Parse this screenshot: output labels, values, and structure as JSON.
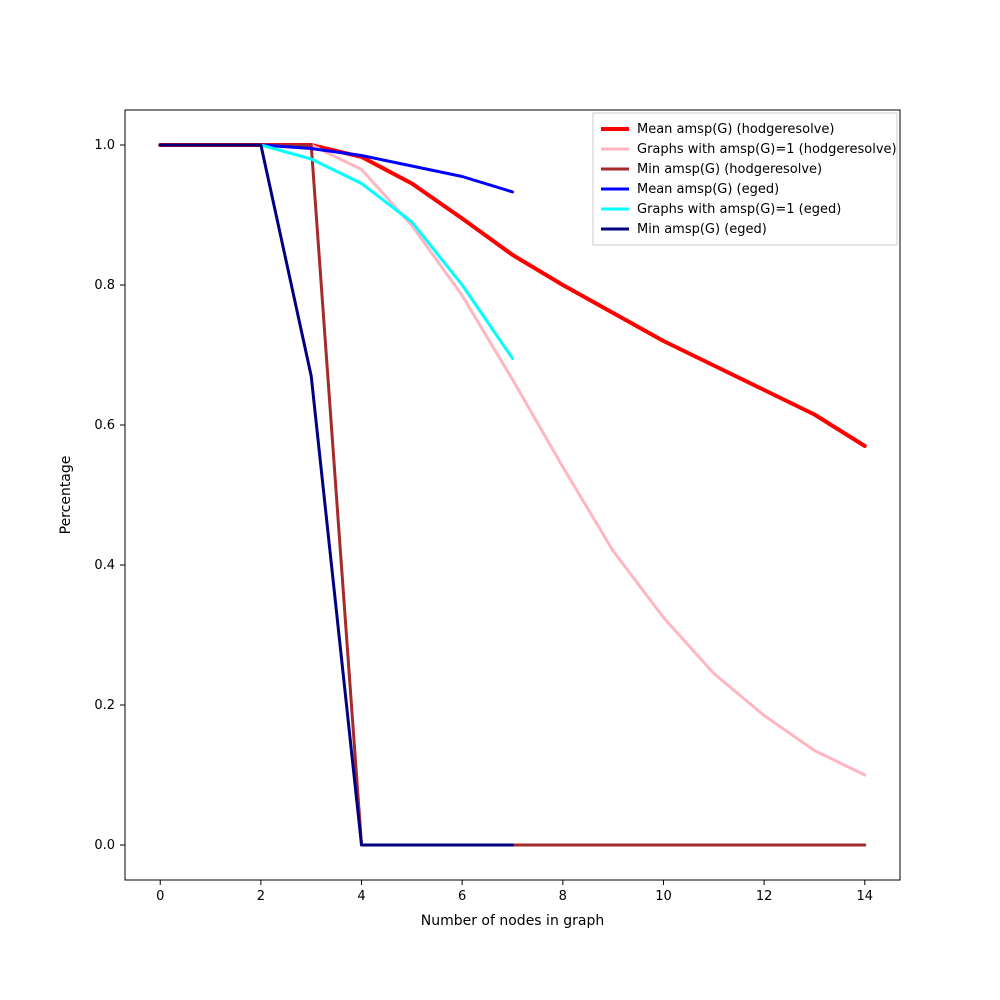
{
  "chart_data": {
    "type": "line",
    "title": "",
    "xlabel": "Number of nodes in graph",
    "ylabel": "Percentage",
    "xlim": [
      -0.7,
      14.7
    ],
    "ylim": [
      -0.05,
      1.05
    ],
    "xticks": [
      0,
      2,
      4,
      6,
      8,
      10,
      12,
      14
    ],
    "yticks": [
      0.0,
      0.2,
      0.4,
      0.6,
      0.8,
      1.0
    ],
    "legend_position": "upper-right-inside",
    "series": [
      {
        "name": "Mean amsp(G) (hodgeresolve)",
        "color": "#ff0000",
        "width": 4,
        "x": [
          0,
          1,
          2,
          3,
          4,
          5,
          6,
          7,
          8,
          9,
          10,
          11,
          12,
          13,
          14
        ],
        "y": [
          1.0,
          1.0,
          1.0,
          1.0,
          0.983,
          0.945,
          0.895,
          0.843,
          0.8,
          0.76,
          0.72,
          0.685,
          0.65,
          0.615,
          0.57
        ]
      },
      {
        "name": "Graphs with amsp(G)=1 (hodgeresolve)",
        "color": "#ffb6c1",
        "width": 3,
        "x": [
          0,
          1,
          2,
          3,
          4,
          5,
          6,
          7,
          8,
          9,
          10,
          11,
          12,
          13,
          14
        ],
        "y": [
          1.0,
          1.0,
          1.0,
          1.0,
          0.965,
          0.885,
          0.785,
          0.665,
          0.54,
          0.42,
          0.325,
          0.245,
          0.185,
          0.135,
          0.1
        ]
      },
      {
        "name": "Min amsp(G) (hodgeresolve)",
        "color": "#a52a2a",
        "width": 3,
        "x": [
          0,
          1,
          2,
          3,
          4,
          5,
          6,
          7,
          8,
          9,
          10,
          11,
          12,
          13,
          14
        ],
        "y": [
          1.0,
          1.0,
          1.0,
          1.0,
          0.0,
          0.0,
          0.0,
          0.0,
          0.0,
          0.0,
          0.0,
          0.0,
          0.0,
          0.0,
          0.0
        ]
      },
      {
        "name": "Mean amsp(G) (eged)",
        "color": "#0000ff",
        "width": 3,
        "x": [
          0,
          1,
          2,
          3,
          4,
          5,
          6,
          7
        ],
        "y": [
          1.0,
          1.0,
          1.0,
          0.995,
          0.985,
          0.97,
          0.955,
          0.933
        ]
      },
      {
        "name": "Graphs with amsp(G)=1 (eged)",
        "color": "#00ffff",
        "width": 3,
        "x": [
          0,
          1,
          2,
          3,
          4,
          5,
          6,
          7
        ],
        "y": [
          1.0,
          1.0,
          1.0,
          0.98,
          0.945,
          0.89,
          0.8,
          0.695
        ]
      },
      {
        "name": "Min amsp(G) (eged)",
        "color": "#000080",
        "width": 3,
        "x": [
          0,
          1,
          2,
          3,
          4,
          5,
          6,
          7
        ],
        "y": [
          1.0,
          1.0,
          1.0,
          0.67,
          0.0,
          0.0,
          0.0,
          0.0
        ]
      }
    ]
  }
}
